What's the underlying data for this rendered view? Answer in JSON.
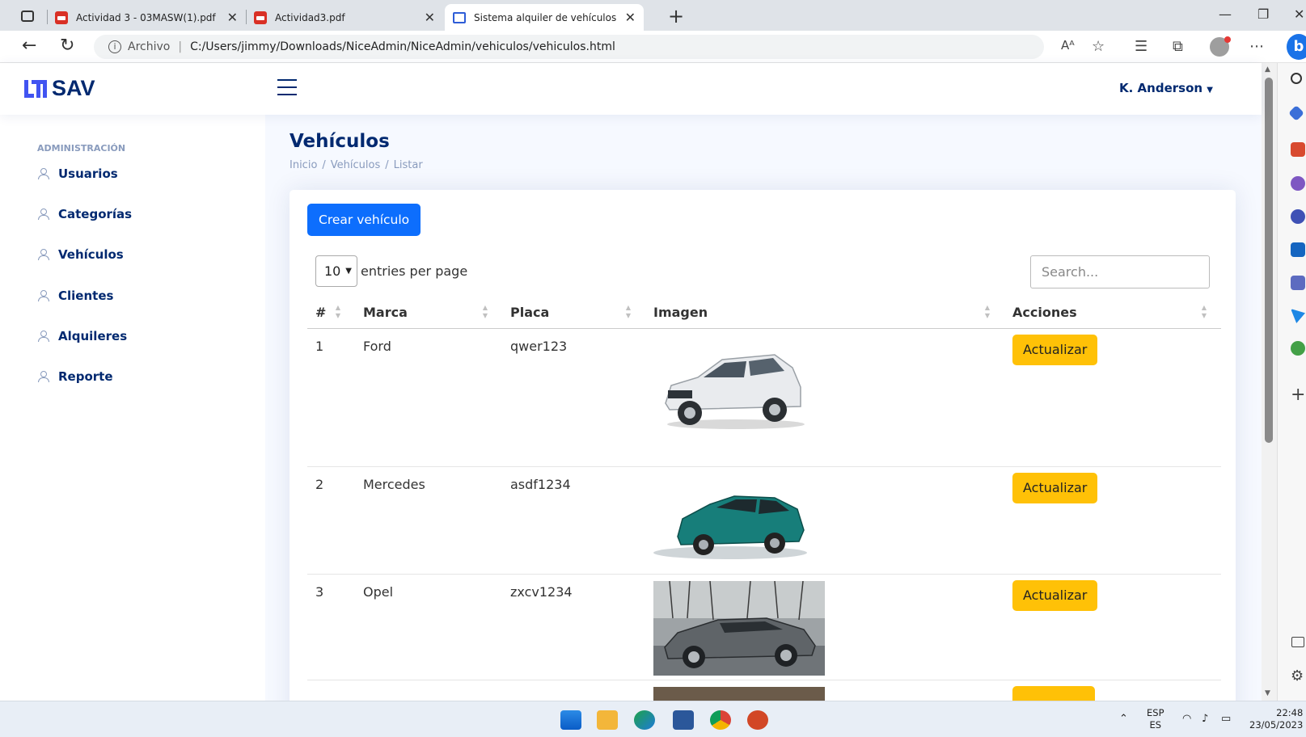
{
  "browser": {
    "tabs": [
      {
        "title": "Actividad 3 - 03MASW(1).pdf",
        "icon": "pdf-icon"
      },
      {
        "title": "Actividad3.pdf",
        "icon": "pdf-icon"
      },
      {
        "title": "Sistema alquiler de vehículos",
        "icon": "site-logo-icon",
        "active": true
      }
    ],
    "address": {
      "scheme_label": "Archivo",
      "url": "C:/Users/jimmy/Downloads/NiceAdmin/NiceAdmin/vehiculos/vehiculos.html"
    }
  },
  "header": {
    "logo_text": "SAV",
    "user_name": "K. Anderson"
  },
  "sidebar": {
    "heading": "ADMINISTRACIÓN",
    "items": [
      {
        "label": "Usuarios"
      },
      {
        "label": "Categorías"
      },
      {
        "label": "Vehículos"
      },
      {
        "label": "Clientes"
      },
      {
        "label": "Alquileres"
      },
      {
        "label": "Reporte"
      }
    ]
  },
  "main": {
    "title": "Vehículos",
    "breadcrumb": [
      "Inicio",
      "Vehículos",
      "Listar"
    ],
    "create_button": "Crear vehículo",
    "per_page_value": "10",
    "per_page_label": "entries per page",
    "search_placeholder": "Search...",
    "columns": [
      "#",
      "Marca",
      "Placa",
      "Imagen",
      "Acciones"
    ],
    "rows": [
      {
        "num": "1",
        "marca": "Ford",
        "placa": "qwer123",
        "image": "white SUV",
        "action": "Actualizar"
      },
      {
        "num": "2",
        "marca": "Mercedes",
        "placa": "asdf1234",
        "image": "teal SUV",
        "action": "Actualizar"
      },
      {
        "num": "3",
        "marca": "Opel",
        "placa": "zxcv1234",
        "image": "grey sedan",
        "action": "Actualizar"
      }
    ]
  },
  "taskbar": {
    "lang_top": "ESP",
    "lang_bottom": "ES",
    "time": "22:48",
    "date": "23/05/2023"
  },
  "colors": {
    "brand": "#012970",
    "primary_button": "#0d6efd",
    "warning_button": "#ffc107",
    "sidebar_muted": "#899bbd",
    "main_bg": "#f6f9ff"
  }
}
